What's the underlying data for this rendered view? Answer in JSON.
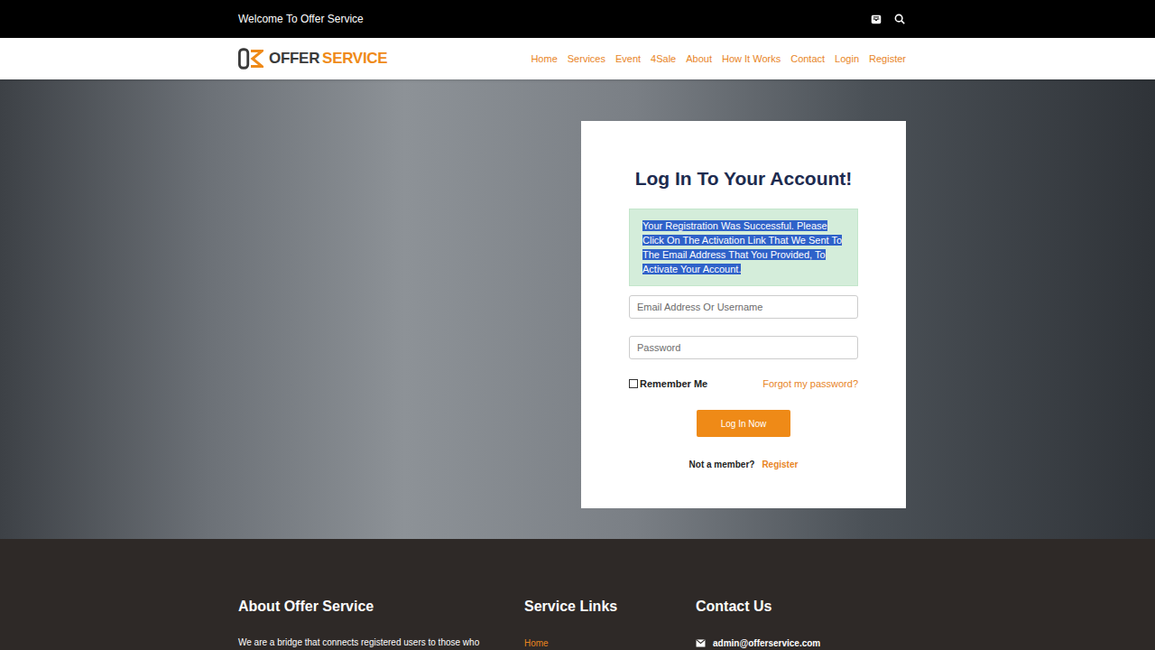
{
  "topbar": {
    "welcome": "Welcome To Offer Service"
  },
  "logo": {
    "first": "OFFER",
    "second": "SERVICE"
  },
  "nav": [
    "Home",
    "Services",
    "Event",
    "4Sale",
    "About",
    "How It Works",
    "Contact",
    "Login",
    "Register"
  ],
  "login": {
    "title": "Log In To Your Account!",
    "alert": {
      "text": "Your Registration Was Successful. Please Click On The Activation Link That We Sent To The Email Address That You Provided, To Activate Your Account.",
      "selected": true
    },
    "fields": [
      {
        "placeholder": "Email Address Or Username",
        "type": "text"
      },
      {
        "placeholder": "Password",
        "type": "password"
      }
    ],
    "remember": {
      "label": "Remember Me",
      "checked": false
    },
    "forgot": "Forgot my password?",
    "button": "Log In Now",
    "prompt": "Not a member?",
    "register": "Register"
  },
  "footer": {
    "about": {
      "heading": "About Offer Service",
      "text": "We are a bridge that connects registered users to those who"
    },
    "links": {
      "heading": "Service Links",
      "items": [
        "Home"
      ]
    },
    "contact": {
      "heading": "Contact Us",
      "email": "admin@offerservice.com"
    }
  }
}
